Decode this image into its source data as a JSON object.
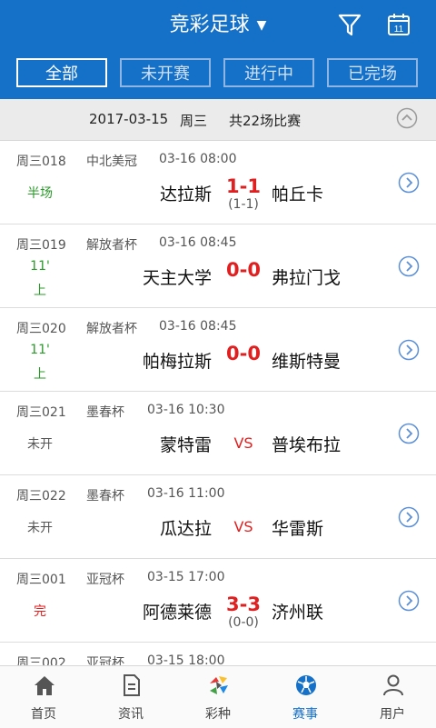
{
  "header": {
    "title": "竞彩足球",
    "caret": "▼",
    "calendar_day": "11"
  },
  "filters": [
    "全部",
    "未开赛",
    "进行中",
    "已完场"
  ],
  "date_bar": {
    "date": "2017-03-15",
    "weekday": "周三",
    "count": "共22场比赛"
  },
  "matches": [
    {
      "id": "周三018",
      "league": "中北美冠",
      "time": "03-16 08:00",
      "status": [
        "半场"
      ],
      "status_color": "#2a9a2a",
      "home": "达拉斯",
      "score": "1-1",
      "half": "(1-1)",
      "away": "帕丘卡"
    },
    {
      "id": "周三019",
      "league": "解放者杯",
      "time": "03-16 08:45",
      "status": [
        "11'",
        "上"
      ],
      "status_color": "#2a9a2a",
      "home": "天主大学",
      "score": "0-0",
      "half": "",
      "away": "弗拉门戈"
    },
    {
      "id": "周三020",
      "league": "解放者杯",
      "time": "03-16 08:45",
      "status": [
        "11'",
        "上"
      ],
      "status_color": "#2a9a2a",
      "home": "帕梅拉斯",
      "score": "0-0",
      "half": "",
      "away": "维斯特曼"
    },
    {
      "id": "周三021",
      "league": "墨春杯",
      "time": "03-16 10:30",
      "status": [
        "未开"
      ],
      "status_color": "#555555",
      "home": "蒙特雷",
      "score": "VS",
      "half": "",
      "away": "普埃布拉"
    },
    {
      "id": "周三022",
      "league": "墨春杯",
      "time": "03-16 11:00",
      "status": [
        "未开"
      ],
      "status_color": "#555555",
      "home": "瓜达拉",
      "score": "VS",
      "half": "",
      "away": "华雷斯"
    },
    {
      "id": "周三001",
      "league": "亚冠杯",
      "time": "03-15 17:00",
      "status": [
        "完"
      ],
      "status_color": "#e02020",
      "home": "阿德莱德",
      "score": "3-3",
      "half": "(0-0)",
      "away": "济州联"
    },
    {
      "id": "周三002",
      "league": "亚冠杯",
      "time": "03-15 18:00",
      "status": [],
      "status_color": "#555555",
      "home": "",
      "score": "",
      "half": "",
      "away": ""
    }
  ],
  "tabbar": [
    {
      "label": "首页",
      "icon": "home-icon",
      "active": false
    },
    {
      "label": "资讯",
      "icon": "news-icon",
      "active": false
    },
    {
      "label": "彩种",
      "icon": "lottery-icon",
      "active": false
    },
    {
      "label": "赛事",
      "icon": "football-icon",
      "active": true
    },
    {
      "label": "用户",
      "icon": "user-icon",
      "active": false
    }
  ],
  "colors": {
    "brand": "#1570c8",
    "score": "#e02020",
    "live": "#2a9a2a",
    "arrow": "#5b8fd6"
  }
}
